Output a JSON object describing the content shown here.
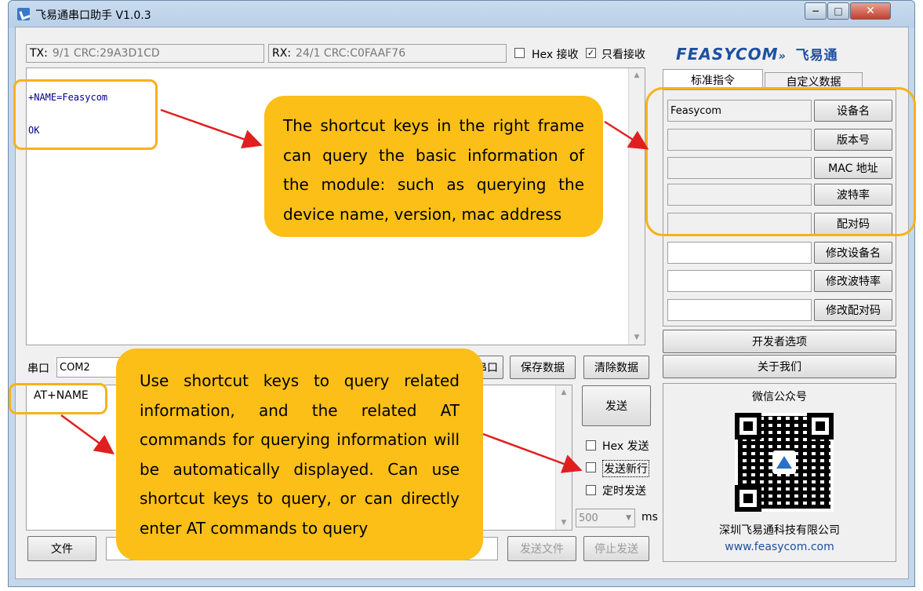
{
  "window": {
    "title": "飞易通串口助手 V1.0.3",
    "min": "−",
    "max": "□",
    "close": "✕"
  },
  "top": {
    "tx_label": "TX:",
    "tx_value": "9/1 CRC:29A3D1CD",
    "rx_label": "RX:",
    "rx_value": "24/1 CRC:C0FAAF76",
    "hex_recv": "Hex 接收",
    "only_view_recv": "只看接收",
    "hex_recv_checked": false,
    "only_view_checked": true
  },
  "receive": {
    "line1": "+NAME=Feasycom",
    "line2": "OK"
  },
  "serial": {
    "port_label": "串口",
    "port_value": "COM2",
    "open_btn_partial": "串口",
    "save_btn": "保存数据",
    "clear_btn": "清除数据"
  },
  "send": {
    "text": "AT+NAME",
    "send_btn": "发送",
    "hex_send": "Hex 发送",
    "send_newline": "发送新行",
    "timed_send": "定时发送",
    "interval": "500",
    "unit": "ms",
    "file_btn": "文件",
    "send_file_btn": "发送文件",
    "stop_send_btn": "停止发送"
  },
  "brand": {
    "logo": "FEASYCOM",
    "logo_cn": "飞易通"
  },
  "tabs": [
    "标准指令",
    "自定义数据"
  ],
  "commands": [
    {
      "value": "Feasycom",
      "label": "设备名"
    },
    {
      "value": "",
      "label": "版本号"
    },
    {
      "value": "",
      "label": "MAC 地址"
    },
    {
      "value": "",
      "label": "波特率"
    },
    {
      "value": "",
      "label": "配对码"
    },
    {
      "value": "",
      "label": "修改设备名"
    },
    {
      "value": "",
      "label": "修改波特率"
    },
    {
      "value": "",
      "label": "修改配对码"
    }
  ],
  "dev_options": "开发者选项",
  "about": "关于我们",
  "wechat": {
    "title": "微信公众号",
    "company": "深圳飞易通科技有限公司",
    "url": "www.feasycom.com"
  },
  "callouts": {
    "right": "The shortcut keys in the right frame can query the basic information of the module: such as querying the device name, version, mac address",
    "bottom": "Use shortcut keys to query related information, and the related AT commands for querying information will be automatically displayed. Can use shortcut keys to query, or can directly enter AT commands to query"
  },
  "colors": {
    "callout": "#fbbf17",
    "highlight": "#f6b21a",
    "arrow": "#e02020",
    "brand": "#1d4fa3"
  }
}
